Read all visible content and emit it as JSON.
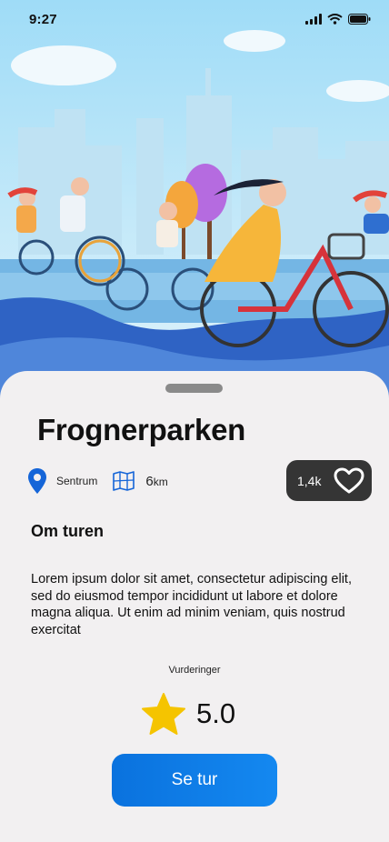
{
  "status": {
    "time": "9:27"
  },
  "place": {
    "title": "Frognerparken",
    "location": "Sentrum",
    "distance_value": "6",
    "distance_unit": "km",
    "likes": "1,4k"
  },
  "about": {
    "heading": "Om turen",
    "text": "Lorem ipsum dolor sit amet, consectetur adipiscing elit, sed do eiusmod tempor incididunt ut labore et dolore magna aliqua. Ut enim ad minim veniam, quis nostrud exercitat"
  },
  "ratings": {
    "label": "Vurderinger",
    "score": "5.0"
  },
  "cta": {
    "label": "Se tur"
  },
  "icons": {
    "location": "map-pin-icon",
    "map": "map-icon",
    "like": "heart-icon",
    "star": "star-icon"
  },
  "colors": {
    "accent": "#0a72de",
    "pin": "#1565d8",
    "star": "#f5c400",
    "likes_bg": "#353535"
  }
}
